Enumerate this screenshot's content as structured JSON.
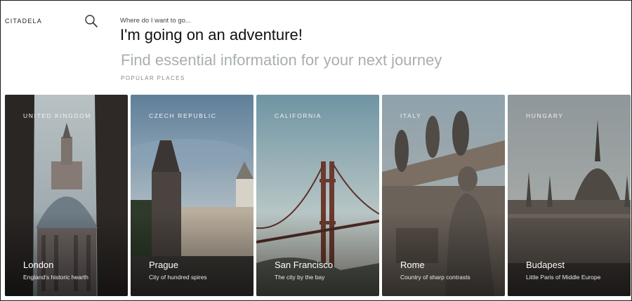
{
  "header": {
    "brand": "CITADELA",
    "search_icon": "search-icon",
    "kicker": "Where do I want to go...",
    "headline": "I'm going on an adventure!",
    "subline": "Find essential information for your next journey",
    "popular_label": "POPULAR PLACES"
  },
  "cards": [
    {
      "country": "UNITED KINGDOM",
      "city": "London",
      "tagline": "England's historic hearth"
    },
    {
      "country": "CZECH REPUBLIC",
      "city": "Prague",
      "tagline": "City of hundred spires"
    },
    {
      "country": "CALIFORNIA",
      "city": "San Francisco",
      "tagline": "The city by the bay"
    },
    {
      "country": "ITALY",
      "city": "Rome",
      "tagline": "Country of sharp contrasts"
    },
    {
      "country": "HUNGARY",
      "city": "Budapest",
      "tagline": "Little Paris of Middle Europe"
    }
  ],
  "colors": {
    "headline": "#111111",
    "subline": "#a9aeb1",
    "border": "#1c1c1c"
  }
}
